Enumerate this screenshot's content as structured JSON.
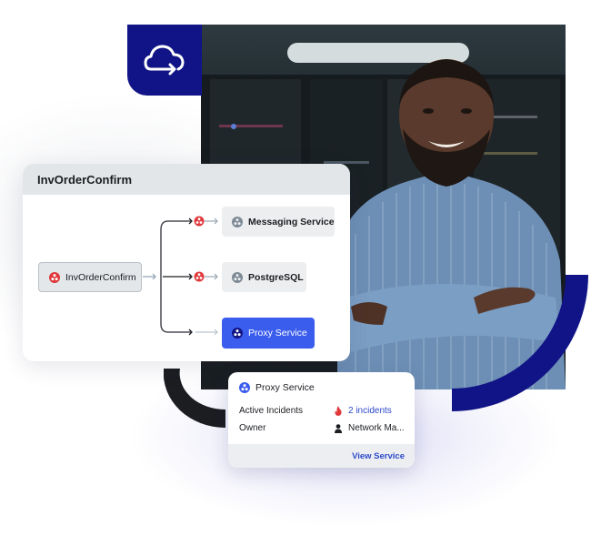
{
  "brand": {
    "logo_icon": "cloud-arrow-icon",
    "accent_color": "#111486",
    "active_color": "#3b5ded",
    "alert_color": "#e0383b",
    "link_color": "#2c49c9"
  },
  "photo": {
    "description": "Smiling man in blue striped shirt with arms crossed in a server room"
  },
  "dependency_map": {
    "title": "InvOrderConfirm",
    "source_node": {
      "label": "InvOrderConfirm",
      "icon": "service-icon",
      "status": "alert"
    },
    "targets": [
      {
        "label": "Messaging Service",
        "icon": "service-icon",
        "status": "alert",
        "selected": false
      },
      {
        "label": "PostgreSQL",
        "icon": "service-icon",
        "status": "alert",
        "selected": false
      },
      {
        "label": "Proxy Service",
        "icon": "service-icon",
        "status": "ok",
        "selected": true
      }
    ]
  },
  "service_popover": {
    "title": "Proxy Service",
    "rows": [
      {
        "key": "Active Incidents",
        "value": "2 incidents",
        "icon": "flame-icon"
      },
      {
        "key": "Owner",
        "value": "Network Ma...",
        "icon": "person-icon"
      }
    ],
    "action_label": "View Service"
  }
}
